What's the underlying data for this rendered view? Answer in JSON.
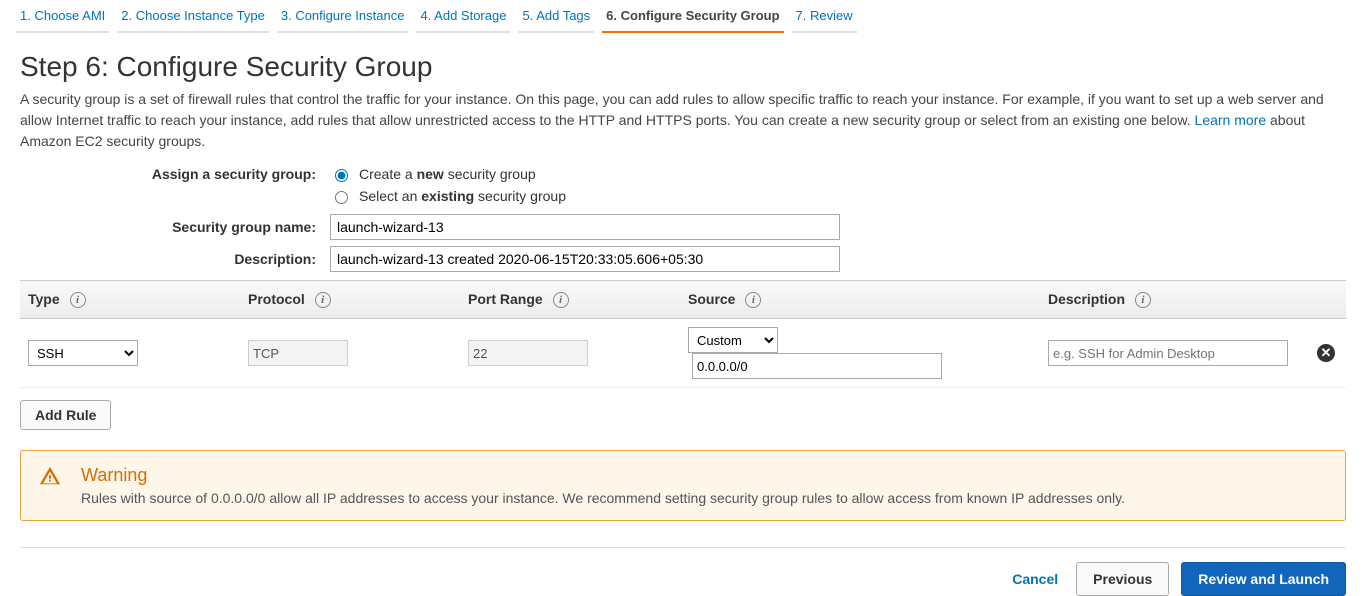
{
  "tabs": [
    {
      "label": "1. Choose AMI"
    },
    {
      "label": "2. Choose Instance Type"
    },
    {
      "label": "3. Configure Instance"
    },
    {
      "label": "4. Add Storage"
    },
    {
      "label": "5. Add Tags"
    },
    {
      "label": "6. Configure Security Group"
    },
    {
      "label": "7. Review"
    }
  ],
  "active_tab_index": 5,
  "heading": "Step 6: Configure Security Group",
  "blurb_pre": "A security group is a set of firewall rules that control the traffic for your instance. On this page, you can add rules to allow specific traffic to reach your instance. For example, if you want to set up a web server and allow Internet traffic to reach your instance, add rules that allow unrestricted access to the HTTP and HTTPS ports. You can create a new security group or select from an existing one below. ",
  "blurb_link": "Learn more",
  "blurb_post": " about Amazon EC2 security groups.",
  "assign_label": "Assign a security group:",
  "radio_create_pre": "Create a ",
  "radio_create_bold": "new",
  "radio_create_post": " security group",
  "radio_existing_pre": "Select an ",
  "radio_existing_bold": "existing",
  "radio_existing_post": " security group",
  "sg_name_label": "Security group name:",
  "sg_name_value": "launch-wizard-13",
  "sg_desc_label": "Description:",
  "sg_desc_value": "launch-wizard-13 created 2020-06-15T20:33:05.606+05:30",
  "table_headers": {
    "type": "Type",
    "protocol": "Protocol",
    "port": "Port Range",
    "source": "Source",
    "desc": "Description"
  },
  "rule": {
    "type": "SSH",
    "protocol": "TCP",
    "port": "22",
    "source_mode": "Custom",
    "source_cidr": "0.0.0.0/0",
    "desc_placeholder": "e.g. SSH for Admin Desktop"
  },
  "add_rule_label": "Add Rule",
  "warning": {
    "title": "Warning",
    "text": "Rules with source of 0.0.0.0/0 allow all IP addresses to access your instance. We recommend setting security group rules to allow access from known IP addresses only."
  },
  "footer": {
    "cancel": "Cancel",
    "previous": "Previous",
    "launch": "Review and Launch"
  }
}
